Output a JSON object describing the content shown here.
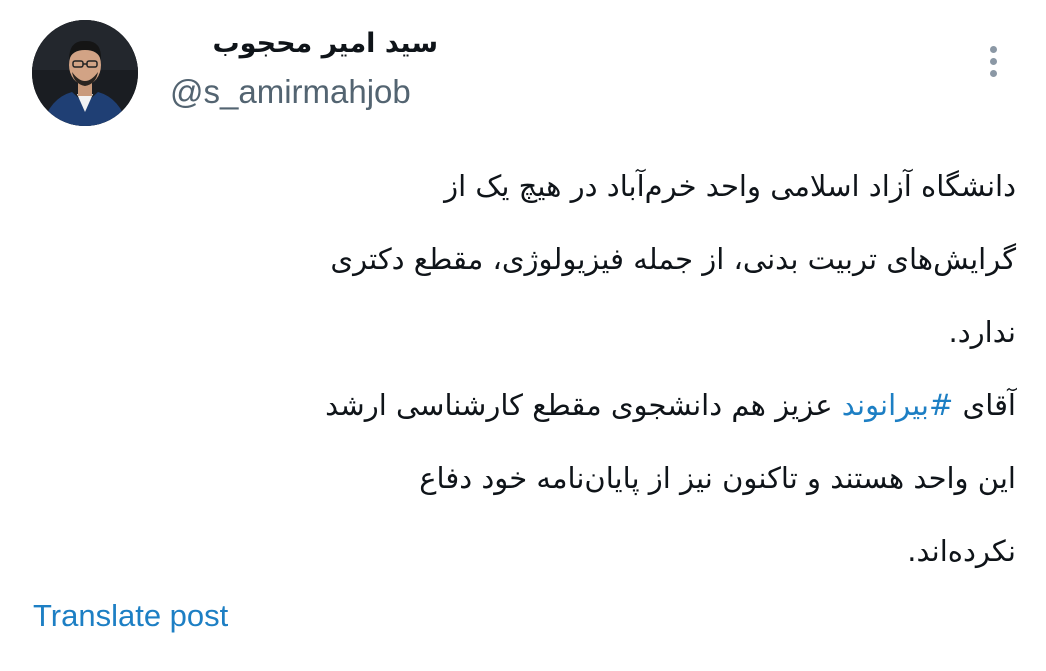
{
  "author": {
    "display_name": "سید امیر محجوب",
    "handle": "@s_amirmahjob",
    "avatar_icon": "profile-photo"
  },
  "menu": {
    "icon": "more-options-icon"
  },
  "tweet": {
    "line1": "دانشگاه آزاد اسلامی واحد خرم‌آباد در هیچ یک از",
    "line2": "گرایش‌های تربیت بدنی، از جمله فیزیولوژی، مقطع دکتری",
    "line3": "ندارد.",
    "line4_before": "آقای ",
    "hashtag": "#بیرانوند",
    "line4_after": " عزیز هم دانشجوی مقطع کارشناسی ارشد",
    "line5": "این واحد هستند و تاکنون نیز از پایان‌نامه خود دفاع",
    "line6": "نکرده‌اند."
  },
  "actions": {
    "translate_label": "Translate post"
  },
  "colors": {
    "text": "#0f1419",
    "secondary": "#536471",
    "link": "#1d7fc4",
    "background": "#ffffff"
  }
}
